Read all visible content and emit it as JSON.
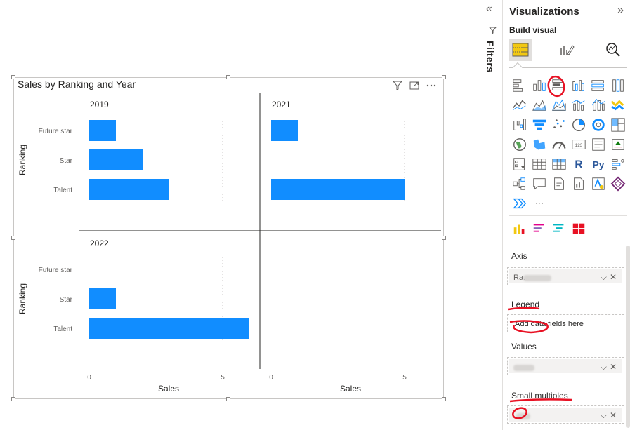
{
  "visual": {
    "title": "Sales by Ranking and Year",
    "header_icons": [
      "filter-icon",
      "focus-mode-icon",
      "more-options-icon"
    ]
  },
  "chart_data": {
    "type": "bar",
    "orientation": "horizontal",
    "small_multiples": true,
    "ylabel": "Ranking",
    "xlabel": "Sales",
    "categories": [
      "Future star",
      "Star",
      "Talent"
    ],
    "x_ticks": [
      0,
      5
    ],
    "xlim": [
      0,
      6
    ],
    "bar_color": "#118DFF",
    "panels": [
      {
        "title": "2019",
        "values": [
          1,
          2,
          3
        ]
      },
      {
        "title": "2021",
        "values": [
          1,
          0,
          5
        ]
      },
      {
        "title": "2022",
        "values": [
          0,
          1,
          6
        ]
      }
    ]
  },
  "filters": {
    "label": "Filters"
  },
  "pane": {
    "title": "Visualizations",
    "build_label": "Build visual",
    "wells": [
      {
        "label": "Axis",
        "value": "Ra...",
        "filled": true
      },
      {
        "label": "Legend",
        "placeholder": "Add data fields here",
        "filled": false
      },
      {
        "label": "Values",
        "value": "...",
        "filled": true
      },
      {
        "label": "Small multiples",
        "value": "Y...",
        "filled": true
      }
    ],
    "gallery": [
      [
        "stacked-bar-icon",
        "stacked-column-icon",
        "clustered-bar-icon",
        "clustered-column-icon",
        "100-stacked-bar-icon",
        "100-stacked-column-icon"
      ],
      [
        "line-chart-icon",
        "area-chart-icon",
        "stacked-area-icon",
        "line-clustered-column-icon",
        "line-stacked-column-icon",
        "ribbon-chart-icon"
      ],
      [
        "waterfall-icon",
        "funnel-icon",
        "scatter-icon",
        "pie-icon",
        "donut-icon",
        "treemap-icon"
      ],
      [
        "map-icon",
        "filled-map-icon",
        "gauge-icon",
        "card-icon",
        "multi-row-card-icon",
        "kpi-icon"
      ],
      [
        "slicer-icon",
        "table-icon",
        "matrix-icon",
        "r-visual-icon",
        "python-visual-icon",
        "key-influencers-icon"
      ],
      [
        "decomposition-tree-icon",
        "qa-icon",
        "smart-narrative-icon",
        "paginated-report-icon",
        "azure-map-icon",
        "power-apps-icon"
      ],
      [
        "power-automate-icon",
        "more-visuals-icon"
      ]
    ],
    "custom_visuals": [
      "custom-visual-1-icon",
      "custom-visual-2-icon",
      "custom-visual-3-icon",
      "custom-visual-4-icon"
    ],
    "more_glyph": "···",
    "r_glyph": "R",
    "py_glyph": "Py"
  },
  "colors": {
    "accent": "#118DFF",
    "annotation": "#E81123"
  }
}
